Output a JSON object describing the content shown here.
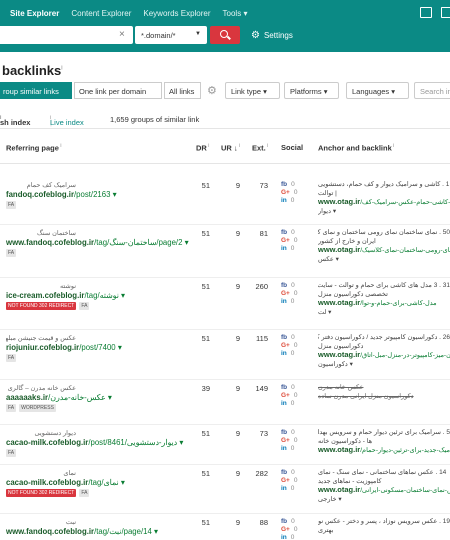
{
  "nav": {
    "items": [
      "Site Explorer",
      "Content Explorer",
      "Keywords Explorer",
      "Tools"
    ]
  },
  "search": {
    "mode": "*.domain/*",
    "settings_label": "Settings"
  },
  "page": {
    "title": "backlinks",
    "title_info": "i"
  },
  "filters": {
    "group_similar": "roup similar links",
    "one_per_domain": "One link per domain",
    "all_links": "All links",
    "link_type": "Link type",
    "platforms": "Platforms",
    "languages": "Languages",
    "search_placeholder": "Search in"
  },
  "index_bar": {
    "fresh_index": "sh index",
    "live_index": "Live index",
    "summary": "1,659 groups of similar link"
  },
  "table": {
    "headers": {
      "referring_page": "Referring page",
      "dr": "DR",
      "ur": "UR",
      "ext": "Ext.",
      "social": "Social",
      "anchor": "Anchor and backlink"
    },
    "rows": [
      {
        "title": "سرامیک کف حمام",
        "url_bold": "fandoq.cofeblog.ir",
        "url_rest": "/post/2163",
        "tags": [
          "FA"
        ],
        "dr": "51",
        "ur": "9",
        "ext": "73",
        "fb": "0",
        "gp": "0",
        "in": "0",
        "anchor_lines": [
          "1 . کاشی و سرامیک دیوار و کف حمام، دستشویی",
          "| توالت"
        ],
        "anchor_domain": "www.otag.ir",
        "anchor_path": "/کاشی-حمام-عکس-سرامیک-کف-",
        "anchor_tail": "دیوار"
      },
      {
        "title": "ساختمان سنگ",
        "url_bold": "www.fandoq.cofeblog.ir",
        "url_rest": "/tag/ساختمان-سنگ/page/2",
        "tags": [
          "FA"
        ],
        "dr": "51",
        "ur": "9",
        "ext": "81",
        "fb": "0",
        "gp": "0",
        "in": "0",
        "anchor_lines": [
          "50 . نمای ساختمان نمای رومی ساختمان و نمای کلاسیک در",
          "ایران و خارج از کشور"
        ],
        "anchor_domain": "www.otag.ir",
        "anchor_path": "/نمای-رومی-ساختمان-نمای-کلاسیک-",
        "anchor_tail": "عکس"
      },
      {
        "title": "نوشته",
        "url_bold": "ice-cream.cofeblog.ir",
        "url_rest": "/tag/نوشته",
        "tags": [
          "NOT FOUND 302 REDIRECT",
          "FA"
        ],
        "dr": "51",
        "ur": "9",
        "ext": "260",
        "fb": "0",
        "gp": "0",
        "in": "0",
        "anchor_lines": [
          "31 . 3 مدل های کاشی برای حمام و توالت - سایت",
          "تخصصی دکوراسیون منزل"
        ],
        "anchor_domain": "www.otag.ir",
        "anchor_path": "/مدل-کاشی-برای-حمام-و-توا",
        "anchor_tail": "لت"
      },
      {
        "title": "عکس و قیمت جنیشن مبلهای مبلمان اداری",
        "url_bold": "riojuniur.cofeblog.ir",
        "url_rest": "/post/7400",
        "tags": [
          "FA"
        ],
        "dr": "51",
        "ur": "9",
        "ext": "115",
        "fb": "0",
        "gp": "0",
        "in": "0",
        "anchor_lines": [
          "26 . دکوراسیون کامپیوتر جدید / دکوراسیون دفتر کار -",
          "دکوراسیون منزل"
        ],
        "anchor_domain": "www.otag.ir",
        "anchor_path": "/چیدمان-میز-کامپیوتر-در-منزل-مبل-اتاق-",
        "anchor_tail": "دکوراسیون"
      },
      {
        "title": "عکس خانه مدرن – گالری عکس",
        "url_bold": "aaaaaaks.ir",
        "url_rest": "/عکس-خانه-مدرن",
        "tags": [
          "FA",
          "WORDPRESS"
        ],
        "dr": "39",
        "ur": "9",
        "ext": "149",
        "fb": "0",
        "gp": "0",
        "in": "0",
        "anchor_strike": [
          "عکس خانه مدرن",
          "دکوراسیون منزل ایرانی مدرن ساده"
        ],
        "anchor_lines": [],
        "anchor_domain": "",
        "anchor_path": "",
        "anchor_tail": ""
      },
      {
        "title": "دیوار دستشویی",
        "url_bold": "cacao-milk.cofeblog.ir",
        "url_rest": "/post/8461/دیوار-دستشویی",
        "tags": [
          "FA"
        ],
        "dr": "51",
        "ur": "9",
        "ext": "73",
        "fb": "0",
        "gp": "0",
        "in": "0",
        "anchor_lines": [
          "5 . سرامیک برای ترئین دیوار حمام و سرویس بهداشتی",
          "ها - دکوراسیون خانه"
        ],
        "anchor_domain": "www.otag.ir",
        "anchor_path": "/سرامیک-جدید-برای-ترئین-دیوار-حمام",
        "anchor_tail": ""
      },
      {
        "title": "نمای",
        "url_bold": "cacao-milk.cofeblog.ir",
        "url_rest": "/tag/نمای",
        "tags": [
          "NOT FOUND 302 REDIRECT",
          "FA"
        ],
        "dr": "51",
        "ur": "9",
        "ext": "282",
        "fb": "0",
        "gp": "0",
        "in": "0",
        "anchor_lines": [
          "14 . عکس نماهای ساختمانی - نمای سنگ - نمای",
          "کامپوزیت - نماهای جدید"
        ],
        "anchor_domain": "www.otag.ir",
        "anchor_path": "/عکس-نمای-ساختمان-مسکونی-ایرانی-",
        "anchor_tail": "خارجی"
      },
      {
        "title": "نبت",
        "url_bold": "www.fandoq.cofeblog.ir",
        "url_rest": "/tag/نبت/page/14",
        "tags": [],
        "dr": "51",
        "ur": "9",
        "ext": "88",
        "fb": "0",
        "gp": "0",
        "in": "0",
        "anchor_lines": [
          "19 . عکس سرویس نوزاد ، پسر و دختر - عکس نوزاد",
          "بهتری"
        ],
        "anchor_domain": "",
        "anchor_path": "",
        "anchor_tail": ""
      }
    ]
  }
}
